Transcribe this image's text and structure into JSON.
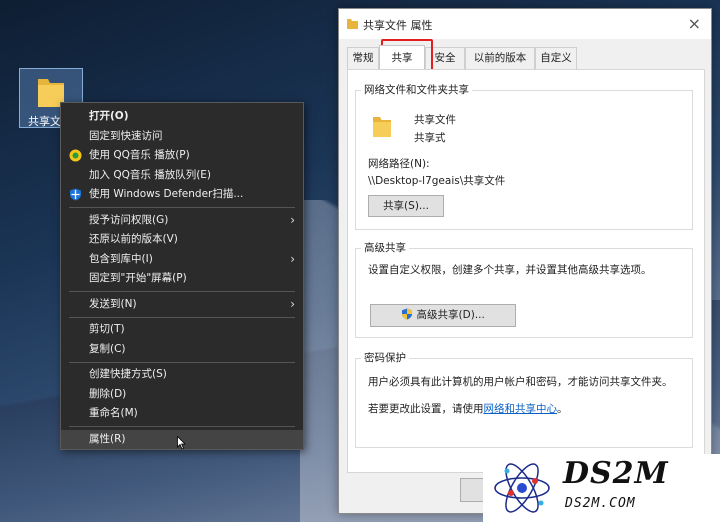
{
  "desktop": {
    "icon_label": "共享文"
  },
  "context_menu": {
    "items": [
      {
        "label": "打开(O)"
      },
      {
        "label": "固定到快速访问"
      },
      {
        "label": "使用 QQ音乐 播放(P)"
      },
      {
        "label": "加入 QQ音乐 播放队列(E)"
      },
      {
        "label": "使用 Windows Defender扫描..."
      },
      {
        "label": "授予访问权限(G)"
      },
      {
        "label": "还原以前的版本(V)"
      },
      {
        "label": "包含到库中(I)"
      },
      {
        "label": "固定到\"开始\"屏幕(P)"
      },
      {
        "label": "发送到(N)"
      },
      {
        "label": "剪切(T)"
      },
      {
        "label": "复制(C)"
      },
      {
        "label": "创建快捷方式(S)"
      },
      {
        "label": "删除(D)"
      },
      {
        "label": "重命名(M)"
      },
      {
        "label": "属性(R)"
      }
    ]
  },
  "window": {
    "title": "共享文件 属性",
    "close": "×",
    "tabs": [
      {
        "label": "常规"
      },
      {
        "label": "共享"
      },
      {
        "label": "安全"
      },
      {
        "label": "以前的版本"
      },
      {
        "label": "自定义"
      }
    ],
    "network_sharing": {
      "title": "网络文件和文件夹共享",
      "name": "共享文件",
      "status": "共享式",
      "path_label": "网络路径(N):",
      "path": "\\\\Desktop-l7geais\\共享文件",
      "button": "共享(S)..."
    },
    "advanced_sharing": {
      "title": "高级共享",
      "description": "设置自定义权限，创建多个共享，并设置其他高级共享选项。",
      "button": "高级共享(D)..."
    },
    "password_protection": {
      "title": "密码保护",
      "description": "用户必须具有此计算机的用户帐户和密码，才能访问共享文件夹。",
      "change_prefix": "若要更改此设置，请使用",
      "link": "网络和共享中心",
      "change_suffix": "。"
    }
  },
  "watermark": {
    "main": "DS2M",
    "sub": "DS2M.COM"
  },
  "colors": {
    "menu_bg": "#2b2b2b",
    "highlight_red": "#e02020",
    "link_blue": "#0b62c4",
    "folder_yellow": "#f3c24c"
  }
}
